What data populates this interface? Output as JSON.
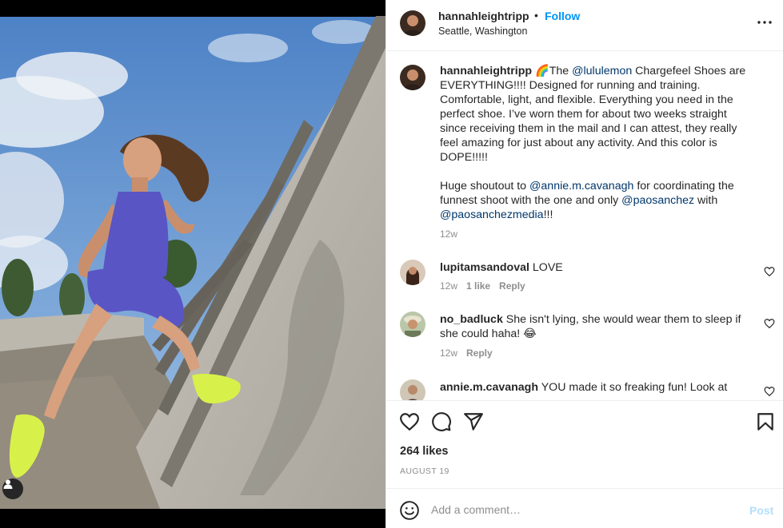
{
  "post": {
    "username": "hannahleightripp",
    "separator": "•",
    "follow_label": "Follow",
    "location": "Seattle, Washington",
    "more_icon": "more-horizontal-icon"
  },
  "caption": {
    "username": "hannahleightripp",
    "emoji": "🌈",
    "part1": "The ",
    "mention1": "@lululemon",
    "part2": " Chargefeel Shoes are EVERYTHING!!!! Designed for running and training. Comfortable, light, and flexible. Everything you need in the perfect shoe. I’ve worn them for about two weeks straight since receiving them in the mail and I can attest, they really feel amazing for just about any activity. And this color is DOPE!!!!!",
    "part3": "Huge shoutout to ",
    "mention2": "@annie.m.cavanagh",
    "part4": " for coordinating the funnest shoot with the one and only ",
    "mention3": "@paosanchez",
    "part5": " with ",
    "mention4": "@paosanchezmedia",
    "part6": "!!!",
    "time": "12w"
  },
  "comments": [
    {
      "username": "lupitamsandoval",
      "text": "LOVE",
      "time": "12w",
      "likes": "1 like",
      "reply": "Reply"
    },
    {
      "username": "no_badluck",
      "text": "She isn't lying, she would wear them to sleep if she could haha! 😂",
      "time": "12w",
      "reply": "Reply"
    },
    {
      "username": "annie.m.cavanagh",
      "text": "YOU made it so freaking fun! Look at"
    }
  ],
  "actions": {
    "like_icon": "heart-icon",
    "comment_icon": "comment-icon",
    "share_icon": "paper-plane-icon",
    "save_icon": "bookmark-icon",
    "likes": "264 likes",
    "date": "AUGUST 19"
  },
  "add_comment": {
    "placeholder": "Add a comment…",
    "post_label": "Post",
    "emoji_icon": "smiley-icon"
  },
  "colors": {
    "link_blue": "#0095f6",
    "mention": "#00376b",
    "muted": "#8e8e8e",
    "post_disabled": "#b2dffc",
    "shoe": "#d8f14a",
    "outfit": "#5a55c4"
  }
}
